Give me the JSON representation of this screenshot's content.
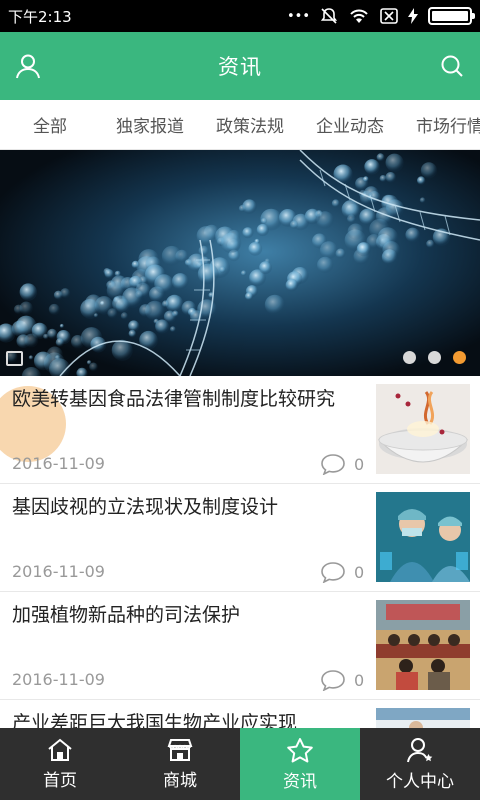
{
  "status_bar": {
    "time": "下午2:13",
    "icons": [
      "more-dots-icon",
      "mute-bell-icon",
      "wifi-icon",
      "no-sim-icon",
      "charging-icon",
      "battery-icon"
    ],
    "battery_level": 1.0
  },
  "header": {
    "title": "资讯",
    "left_icon": "user-icon",
    "right_icon": "search-icon",
    "background": "#3ab77f"
  },
  "tabs": [
    "全部",
    "独家报道",
    "政策法规",
    "企业动态",
    "市场行情"
  ],
  "banner": {
    "slide_count": 3,
    "active_index": 2,
    "active_color": "#f39b32"
  },
  "news": [
    {
      "title": "欧美转基因食品法律管制制度比较研究",
      "date": "2016-11-09",
      "comments": "0"
    },
    {
      "title": "基因歧视的立法现状及制度设计",
      "date": "2016-11-09",
      "comments": "0"
    },
    {
      "title": "加强植物新品种的司法保护",
      "date": "2016-11-09",
      "comments": "0"
    },
    {
      "title": "产业差距巨大我国生物产业应实现",
      "date": "",
      "comments": ""
    }
  ],
  "bottom_nav": [
    {
      "label": "首页",
      "icon": "home-icon"
    },
    {
      "label": "商城",
      "icon": "store-icon"
    },
    {
      "label": "资讯",
      "icon": "star-icon",
      "active": true
    },
    {
      "label": "个人中心",
      "icon": "user-center-icon"
    }
  ]
}
